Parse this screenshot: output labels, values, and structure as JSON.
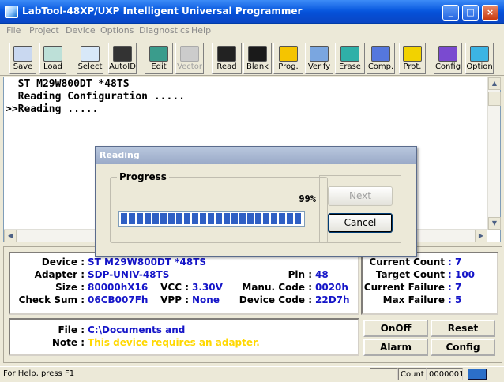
{
  "window": {
    "title": "LabTool-48XP/UXP Intelligent Universal Programmer"
  },
  "menu": [
    "File",
    "Project",
    "Device",
    "Options",
    "Diagnostics",
    "Help"
  ],
  "toolbar": [
    {
      "label": "Save",
      "icon": "save-icon"
    },
    {
      "label": "Load",
      "icon": "load-icon"
    },
    {
      "label": "Select",
      "icon": "select-icon"
    },
    {
      "label": "AutoID",
      "icon": "autoid-icon"
    },
    {
      "label": "Edit",
      "icon": "edit-icon"
    },
    {
      "label": "Vector",
      "icon": "vector-icon",
      "disabled": true
    },
    {
      "label": "Read",
      "icon": "read-icon"
    },
    {
      "label": "Blank",
      "icon": "blank-icon"
    },
    {
      "label": "Prog.",
      "icon": "program-icon"
    },
    {
      "label": "Verify",
      "icon": "verify-icon"
    },
    {
      "label": "Erase",
      "icon": "erase-icon"
    },
    {
      "label": "Comp.",
      "icon": "compare-icon"
    },
    {
      "label": "Prot.",
      "icon": "protect-icon"
    },
    {
      "label": "Config",
      "icon": "config-icon"
    },
    {
      "label": "Option",
      "icon": "option-icon"
    }
  ],
  "log": {
    "lines": [
      "  ST M29W800DT *48TS",
      "  Reading Configuration .....",
      ">>Reading ....."
    ]
  },
  "dialog": {
    "title": "Reading",
    "group_label": "Progress",
    "percent_text": "99%",
    "progress": 0.99,
    "next_label": "Next",
    "cancel_label": "Cancel"
  },
  "info": {
    "device_label": "Device :",
    "device": "ST M29W800DT *48TS",
    "adapter_label": "Adapter :",
    "adapter": "SDP-UNIV-48TS",
    "pin_label": "Pin :",
    "pin": "48",
    "size_label": "Size :",
    "size": "80000hX16",
    "vcc_label": "VCC :",
    "vcc": "3.30V",
    "manu_label": "Manu. Code :",
    "manu": "0020h",
    "checksum_label": "Check Sum :",
    "checksum": "06CB007Fh",
    "vpp_label": "VPP :",
    "vpp": "None",
    "devcode_label": "Device Code :",
    "devcode": "22D7h",
    "file_label": "File :",
    "file": "C:\\Documents and",
    "note_label": "Note :",
    "note": "This device requires an adapter."
  },
  "counts": {
    "current_count_label": "Current Count",
    "current_count": ": 7",
    "target_count_label": "Target Count",
    "target_count": ": 100",
    "current_failure_label": "Current Failure",
    "current_failure": ": 7",
    "max_failure_label": "Max Failure",
    "max_failure": ": 5"
  },
  "panel_buttons": {
    "onoff": "OnOff",
    "reset": "Reset",
    "alarm": "Alarm",
    "config": "Config"
  },
  "status": {
    "help": "For Help, press F1",
    "count_label": "Count",
    "count_value": "0000001"
  }
}
